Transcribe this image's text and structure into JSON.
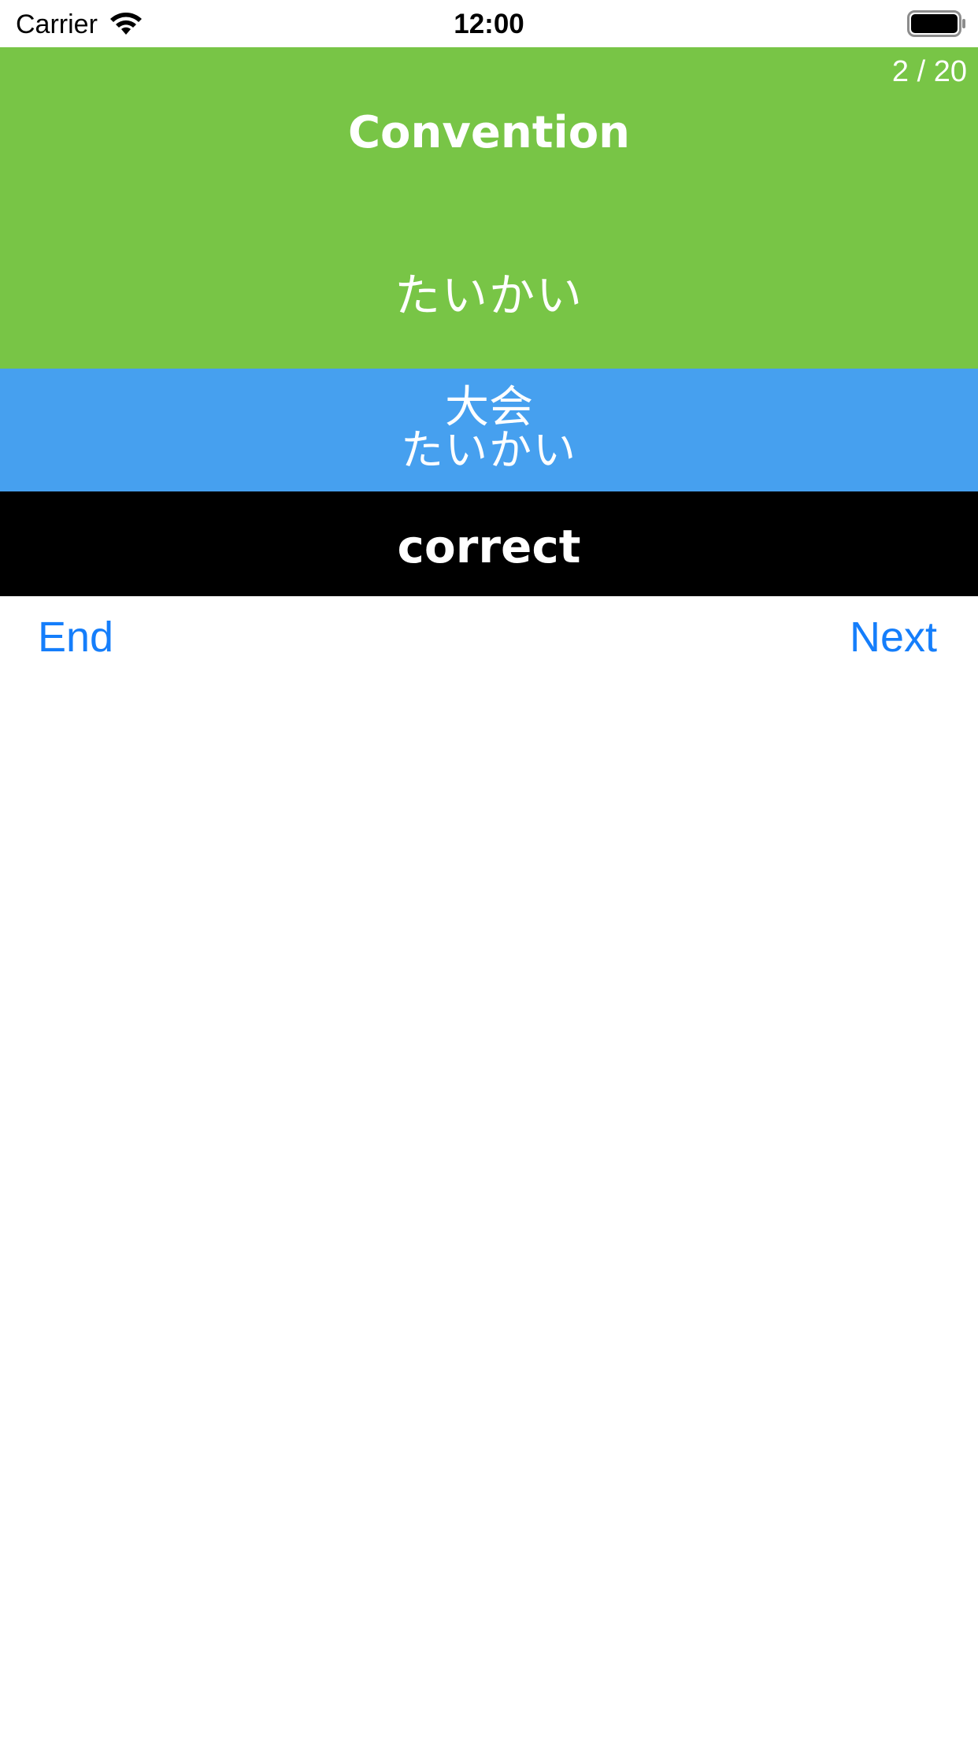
{
  "status_bar": {
    "carrier": "Carrier",
    "time": "12:00",
    "icons": [
      "wifi-icon",
      "battery-icon"
    ]
  },
  "question": {
    "counter": "2 / 20",
    "word": "Convention",
    "reading": "たいかい",
    "background_color": "#78c546"
  },
  "answer": {
    "kanji": "大会",
    "kana": "たいかい",
    "background_color": "#46a0ef"
  },
  "result": {
    "text": "correct",
    "background_color": "#000000"
  },
  "buttons": {
    "end_label": "End",
    "next_label": "Next",
    "color": "#157efb"
  }
}
